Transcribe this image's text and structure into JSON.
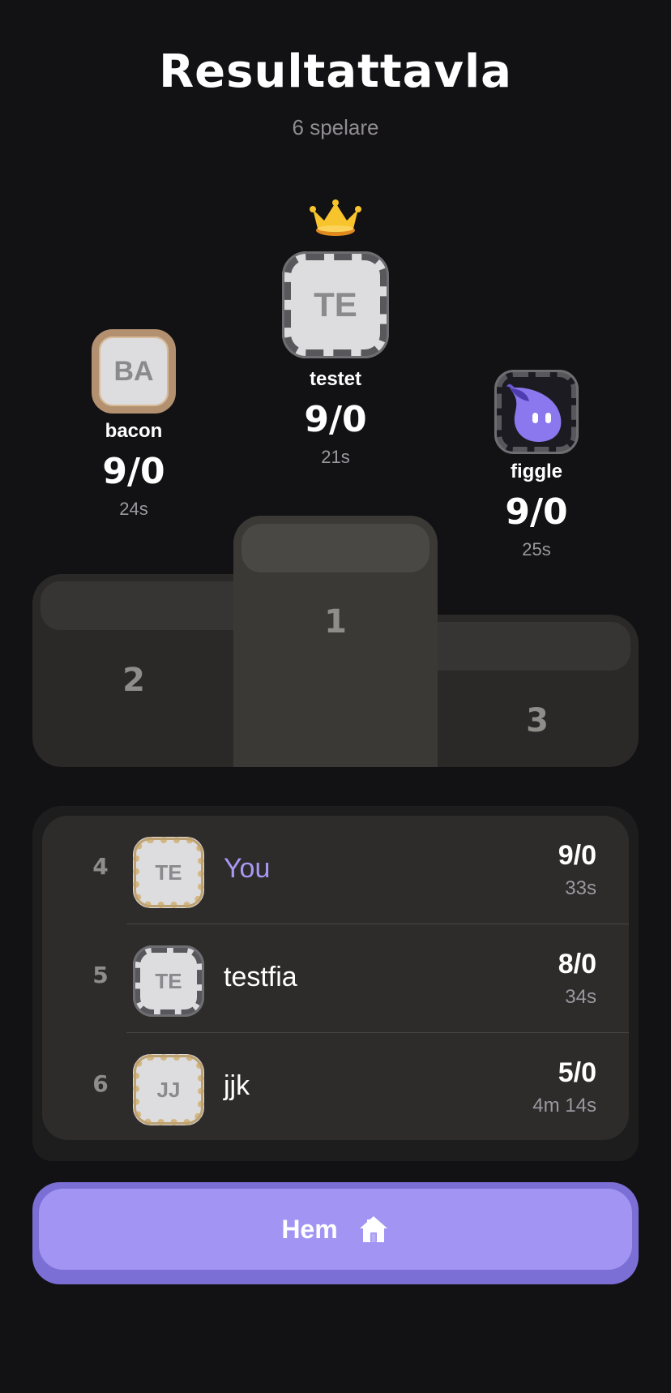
{
  "header": {
    "title": "Resultattavla",
    "subtitle": "6 spelare"
  },
  "podium": {
    "first": {
      "rank": "1",
      "initials": "TE",
      "name": "testet",
      "score": "9/0",
      "time": "21s"
    },
    "second": {
      "rank": "2",
      "initials": "BA",
      "name": "bacon",
      "score": "9/0",
      "time": "24s"
    },
    "third": {
      "rank": "3",
      "initials": "",
      "name": "figgle",
      "score": "9/0",
      "time": "25s"
    }
  },
  "list": [
    {
      "rank": "4",
      "initials": "TE",
      "name": "You",
      "score": "9/0",
      "time": "33s"
    },
    {
      "rank": "5",
      "initials": "TE",
      "name": "testfia",
      "score": "8/0",
      "time": "34s"
    },
    {
      "rank": "6",
      "initials": "JJ",
      "name": "jjk",
      "score": "5/0",
      "time": "4m 14s"
    }
  ],
  "home_button": {
    "label": "Hem",
    "icon": "home-icon"
  },
  "colors": {
    "background": "#121113",
    "accent": "#a194f3",
    "you_highlight": "#a898f3"
  }
}
